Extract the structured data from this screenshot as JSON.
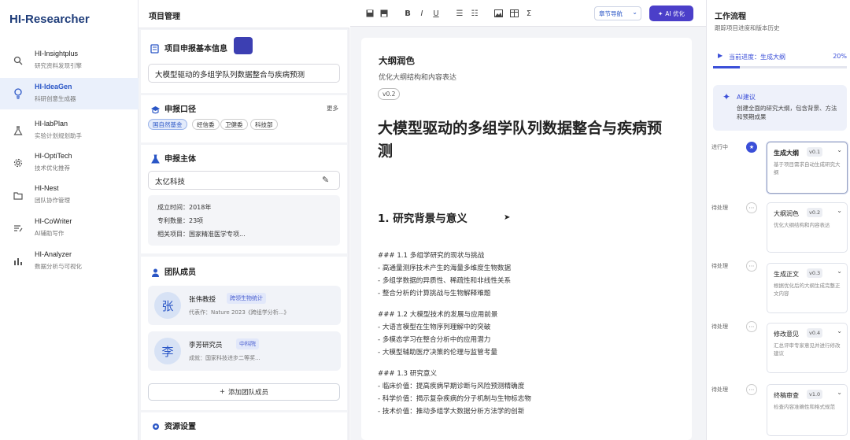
{
  "nav": {
    "logo": "HI-Researcher",
    "items": [
      {
        "title": "HI-Insightplus",
        "sub": "研究资料发现引擎"
      },
      {
        "title": "HI-IdeaGen",
        "sub": "科研创意生成器"
      },
      {
        "title": "HI-labPlan",
        "sub": "实验计划规划助手"
      },
      {
        "title": "HI-OptiTech",
        "sub": "技术优化推荐"
      },
      {
        "title": "HI-Nest",
        "sub": "团队协作管理"
      },
      {
        "title": "HI-CoWriter",
        "sub": "AI辅助写作"
      },
      {
        "title": "HI-Analyzer",
        "sub": "数据分析与可视化"
      }
    ]
  },
  "project": {
    "header": "项目管理",
    "basic_title": "项目申报基本信息",
    "project_name": "大模型驱动的多组学队列数据整合与疾病预测",
    "channel_title": "申报口径",
    "more": "更多",
    "channel_tags": [
      "国自然基金",
      "经信委",
      "卫健委",
      "科技部"
    ],
    "applicant_title": "申报主体",
    "applicant": "太亿科技",
    "applicant_info": [
      "成立时间：2018年",
      "专利数量：23项",
      "相关项目：国家精准医学专项..."
    ],
    "team_title": "团队成员",
    "members": [
      {
        "avatar": "张",
        "name": "张伟教授",
        "badge": "跨领生物统计",
        "desc": "代表作：Nature 2023《跨组学分析...》"
      },
      {
        "avatar": "李",
        "name": "李芳研究员",
        "badge": "中科院",
        "desc": "成就：国家科技进步二等奖..."
      }
    ],
    "add_member": "添加团队成员",
    "resource_title": "资源设置"
  },
  "toolbar": {
    "nav_select": "章节导航",
    "ai_button": "AI 优化"
  },
  "doc": {
    "title": "大纲润色",
    "subtitle": "优化大纲结构和内容表达",
    "version": "v0.2",
    "h1": "大模型驱动的多组学队列数据整合与疾病预测",
    "h2": "1. 研究背景与意义",
    "lines": [
      "### 1.1 多组学研究的现状与挑战",
      "- 高通量测序技术产生的海量多维度生物数据",
      "- 多组学数据的异质性、稀疏性和非线性关系",
      "- 整合分析的计算挑战与生物解释难题",
      "",
      "### 1.2 大模型技术的发展与应用前景",
      "- 大语言模型在生物序列理解中的突破",
      "- 多模态学习在整合分析中的应用潜力",
      "- 大模型辅助医疗决策的伦理与监管考量",
      "",
      "### 1.3 研究意义",
      "- 临床价值：提高疾病早期诊断与风险预测精确度",
      "- 科学价值：揭示复杂疾病的分子机制与生物标志物",
      "- 技术价值：推动多组学大数据分析方法学的创新"
    ]
  },
  "workflow": {
    "title": "工作流程",
    "subtitle": "跟踪项目进度和版本历史",
    "progress_label": "当前进度：生成大纲",
    "progress_percent": "20%",
    "progress_value": 0.2,
    "ai_title": "AI建议",
    "ai_text": "创建全面的研究大纲，包含背景、方法和预期成果",
    "steps": [
      {
        "status": "进行中",
        "name": "生成大纲",
        "version": "v0.1",
        "desc": "基于项目需求自动生成研究大纲"
      },
      {
        "status": "待处理",
        "name": "大纲润色",
        "version": "v0.2",
        "desc": "优化大纲结构和内容表达"
      },
      {
        "status": "待处理",
        "name": "生成正文",
        "version": "v0.3",
        "desc": "根据优化后的大纲生成完整正文内容"
      },
      {
        "status": "待处理",
        "name": "修改意见",
        "version": "v0.4",
        "desc": "汇总评审专家意见并进行修改建议"
      },
      {
        "status": "待处理",
        "name": "终稿审查",
        "version": "v1.0",
        "desc": "检查内容准确性和格式规范"
      }
    ]
  }
}
